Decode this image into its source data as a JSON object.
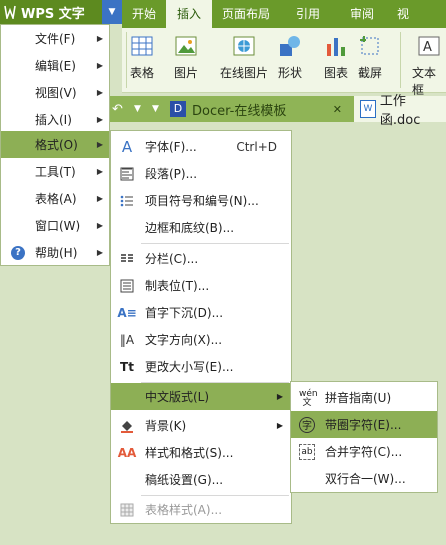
{
  "app": {
    "title": "WPS 文字"
  },
  "ribbon": {
    "tabs": [
      "开始",
      "插入",
      "页面布局",
      "引用",
      "审阅",
      "视"
    ],
    "buttons": {
      "table": "表格",
      "picture": "图片",
      "online_picture": "在线图片",
      "shape": "形状",
      "chart": "图表",
      "screenshot": "截屏",
      "textbox": "文本框"
    }
  },
  "doctabs": {
    "template": "Docer-在线模板",
    "file": "工作函.doc"
  },
  "main_menu": [
    {
      "label": "文件(F)"
    },
    {
      "label": "编辑(E)"
    },
    {
      "label": "视图(V)"
    },
    {
      "label": "插入(I)"
    },
    {
      "label": "格式(O)"
    },
    {
      "label": "工具(T)"
    },
    {
      "label": "表格(A)"
    },
    {
      "label": "窗口(W)"
    },
    {
      "label": "帮助(H)"
    }
  ],
  "format_menu": {
    "font": "字体(F)...",
    "font_shortcut": "Ctrl+D",
    "paragraph": "段落(P)...",
    "bullets": "项目符号和编号(N)...",
    "borders": "边框和底纹(B)...",
    "columns": "分栏(C)...",
    "tabs": "制表位(T)...",
    "dropcap": "首字下沉(D)...",
    "direction": "文字方向(X)...",
    "case": "更改大小写(E)...",
    "chinese": "中文版式(L)",
    "background": "背景(K)",
    "styles": "样式和格式(S)...",
    "paper": "稿纸设置(G)...",
    "table_style": "表格样式(A)..."
  },
  "chinese_menu": {
    "pinyin": "拼音指南(U)",
    "enclosed": "带圈字符(E)...",
    "combine": "合并字符(C)...",
    "twolines": "双行合一(W)..."
  },
  "colors": {
    "accent": "#8daf55",
    "brand": "#5d8a1f",
    "ribbon": "#6a9a2a"
  }
}
